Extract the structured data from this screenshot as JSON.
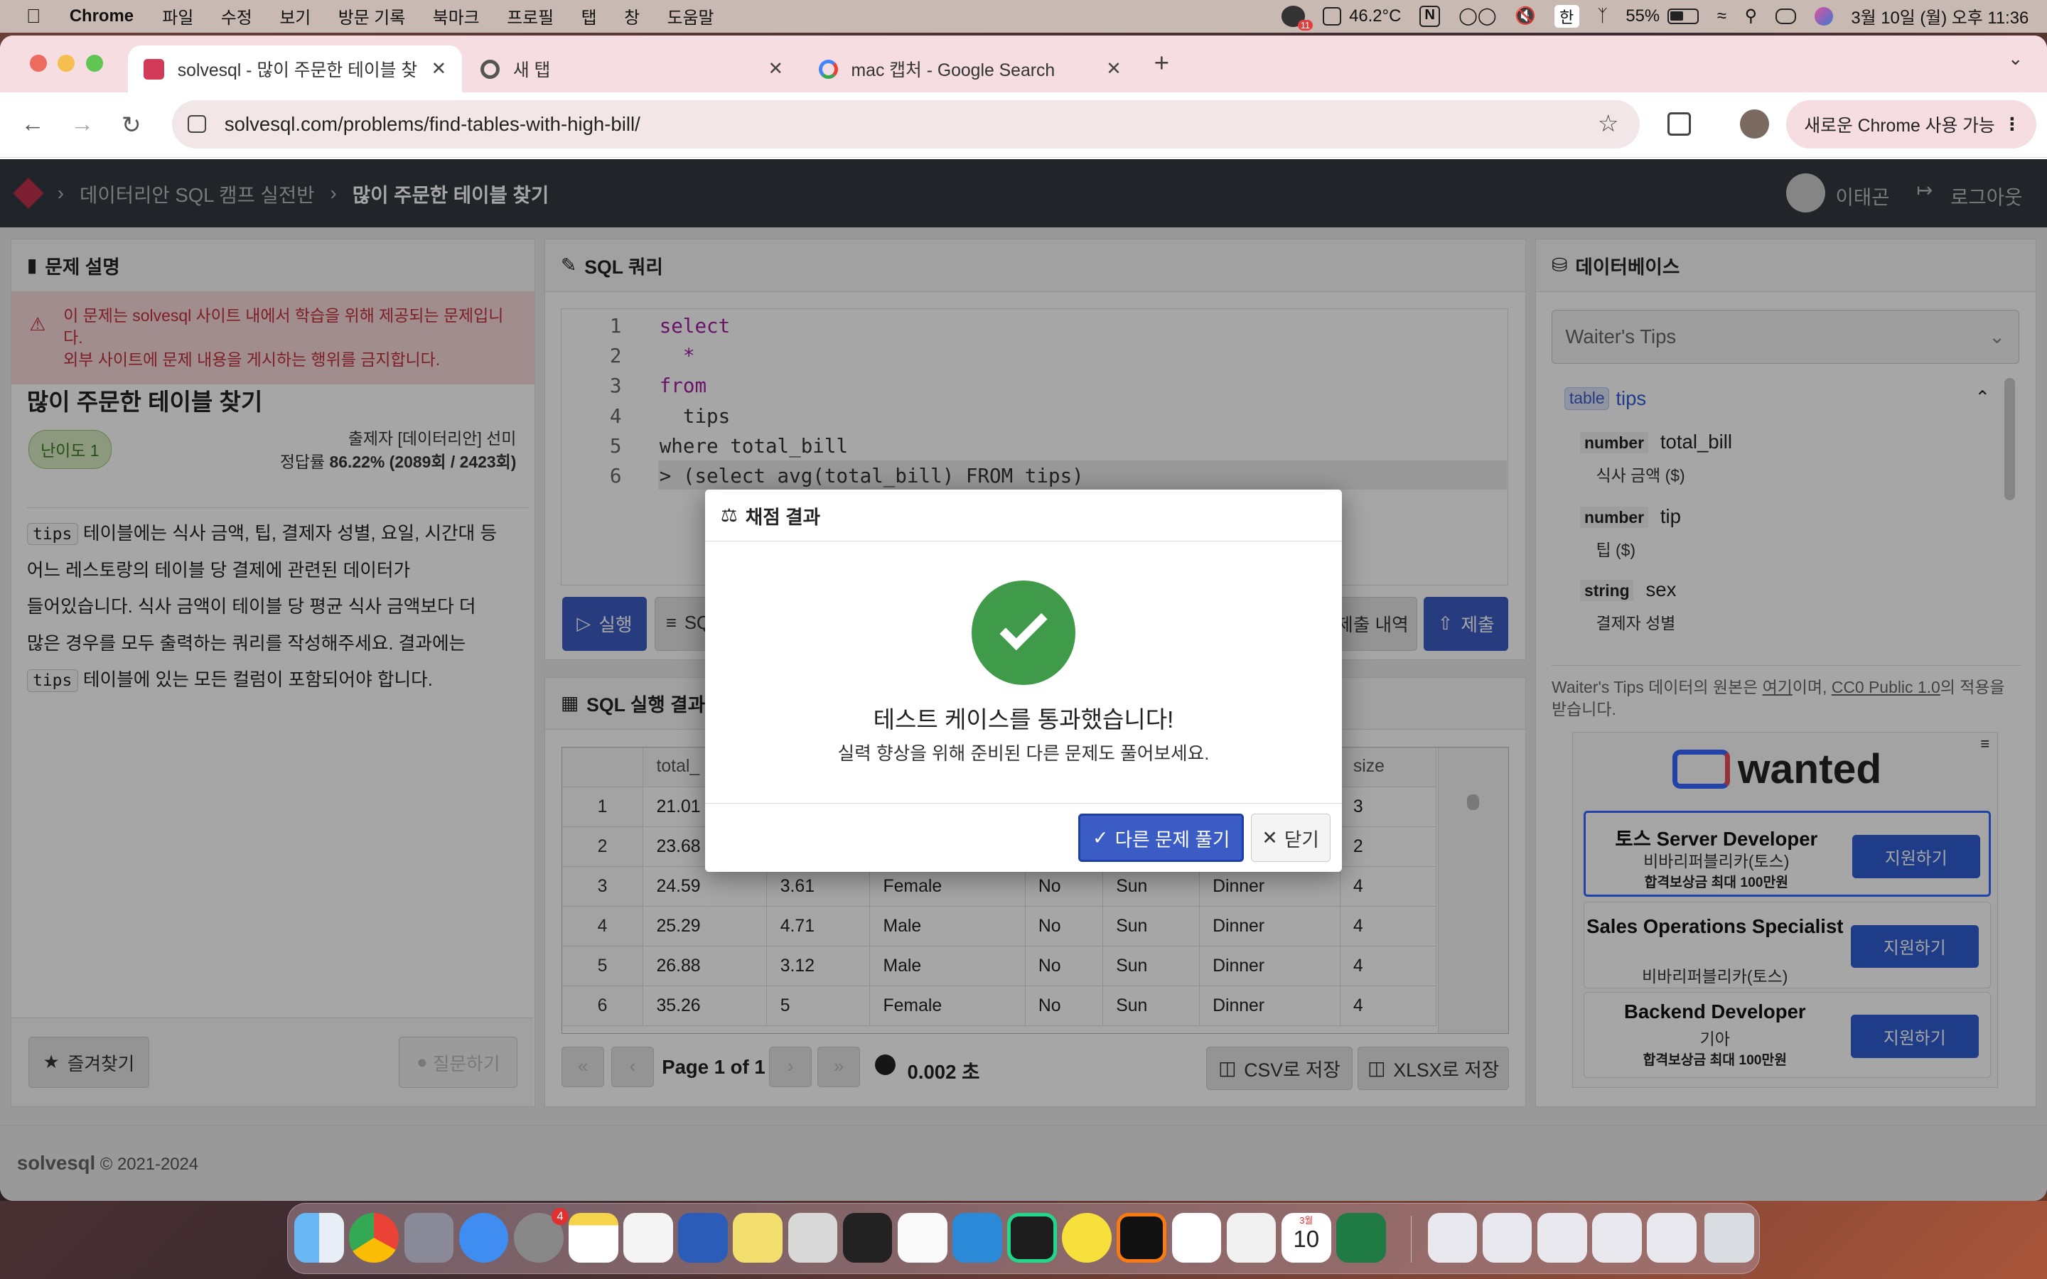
{
  "menubar": {
    "app_name": "Chrome",
    "items": [
      "파일",
      "수정",
      "보기",
      "방문 기록",
      "북마크",
      "프로필",
      "탭",
      "창",
      "도움말"
    ],
    "temp": "46.2°C",
    "battery": "55%",
    "input_lang": "한",
    "datetime": "3월 10일 (월) 오후 11:36",
    "notif_badge": "11"
  },
  "tabs": [
    {
      "title": "solvesql - 많이 주문한 테이블 찾기",
      "active": true
    },
    {
      "title": "새 탭",
      "active": false
    },
    {
      "title": "mac 캡처 - Google Search",
      "active": false
    }
  ],
  "address": {
    "url": "solvesql.com/problems/find-tables-with-high-bill/",
    "new_chrome_label": "새로운 Chrome 사용 가능"
  },
  "site_header": {
    "breadcrumb": [
      "데이터리안 SQL 캠프 실전반",
      "많이 주문한 테이블 찾기"
    ],
    "user": "이태곤",
    "logout": "로그아웃"
  },
  "problem": {
    "panel_title": "문제 설명",
    "warning_line1": "이 문제는 solvesql 사이트 내에서 학습을 위해 제공되는 문제입니다.",
    "warning_line2": "외부 사이트에 문제 내용을 게시하는 행위를 금지합니다.",
    "title": "많이 주문한 테이블 찾기",
    "level": "난이도 1",
    "author_label": "출제자",
    "author": "[데이터리안] 선미",
    "rate_label": "정답률",
    "rate": "86.22% (2089회 / 2423회)",
    "desc_code1": "tips",
    "desc1": "테이블에는 식사 금액, 팁, 결제자 성별, 요일, 시간대 등",
    "desc2": "어느 레스토랑의 테이블 당 결제에 관련된 데이터가",
    "desc3": "들어있습니다. 식사 금액이 테이블 당 평균 식사 금액보다 더",
    "desc4": "많은 경우를 모두 출력하는 쿼리를 작성해주세요. 결과에는",
    "desc_code2": "tips",
    "desc5": "테이블에 있는 모든 컬럼이 포함되어야 합니다.",
    "bookmark": "즐겨찾기",
    "ask": "질문하기"
  },
  "sql": {
    "panel_title": "SQL 쿼리",
    "line_numbers": [
      "1",
      "2",
      "3",
      "4",
      "5",
      "6"
    ],
    "lines": [
      "select",
      "  *",
      "from",
      "  tips",
      "where total_bill",
      "> (select avg(total_bill) FROM tips)"
    ],
    "run": "실행",
    "sql_btn": "SQ",
    "history": "제출 내역",
    "submit": "제출"
  },
  "results": {
    "panel_title": "SQL 실행 결과",
    "columns": [
      "",
      "total_",
      "",
      "",
      "",
      "",
      "",
      "size"
    ],
    "rows": [
      [
        "1",
        "21.01",
        "",
        "",
        "",
        "",
        "",
        "3"
      ],
      [
        "2",
        "23.68",
        "",
        "",
        "",
        "",
        "",
        "2"
      ],
      [
        "3",
        "24.59",
        "3.61",
        "Female",
        "No",
        "Sun",
        "Dinner",
        "4"
      ],
      [
        "4",
        "25.29",
        "4.71",
        "Male",
        "No",
        "Sun",
        "Dinner",
        "4"
      ],
      [
        "5",
        "26.88",
        "3.12",
        "Male",
        "No",
        "Sun",
        "Dinner",
        "4"
      ],
      [
        "6",
        "35.26",
        "5",
        "Female",
        "No",
        "Sun",
        "Dinner",
        "4"
      ]
    ],
    "page": "Page 1 of 1",
    "time": "0.002 초",
    "csv": "CSV로 저장",
    "xlsx": "XLSX로 저장"
  },
  "database": {
    "panel_title": "데이터베이스",
    "select_value": "Waiter's Tips",
    "table_badge": "table",
    "table_name": "tips",
    "columns": [
      {
        "type": "number",
        "name": "total_bill",
        "desc": "식사 금액 ($)"
      },
      {
        "type": "number",
        "name": "tip",
        "desc": "팁 ($)"
      },
      {
        "type": "string",
        "name": "sex",
        "desc": "결제자 성별"
      }
    ],
    "source_pre": "Waiter's Tips 데이터의 원본은 ",
    "source_link1": "여기",
    "source_mid": "이며, ",
    "source_link2": "CC0 Public 1.0",
    "source_post": "의 적용을",
    "source_line2": "받습니다."
  },
  "ads": {
    "brand": "wanted",
    "jobs": [
      {
        "title": "토스 Server Developer",
        "company": "비바리퍼블리카(토스)",
        "reward": "합격보상금 최대 100만원",
        "apply": "지원하기"
      },
      {
        "title": "Sales Operations Specialist",
        "company": "비바리퍼블리카(토스)",
        "reward": "",
        "apply": "지원하기"
      },
      {
        "title": "Backend Developer",
        "company": "기아",
        "reward": "합격보상금 최대 100만원",
        "apply": "지원하기"
      }
    ]
  },
  "footer": {
    "brand": "solvesql",
    "copyright": "© 2021-2024"
  },
  "modal": {
    "title": "채점 결과",
    "message": "테스트 케이스를 통과했습니다!",
    "sub": "실력 향상을 위해 준비된 다른 문제도 풀어보세요.",
    "next": "다른 문제 풀기",
    "close": "닫기"
  },
  "dock": {
    "settings_badge": "4",
    "calendar_month": "3월",
    "calendar_day": "10"
  },
  "colors": {
    "accent": "#3b5cc4",
    "success": "#3f9b4a",
    "warning_bg": "#f8d7da",
    "header_bg": "#343a40"
  }
}
